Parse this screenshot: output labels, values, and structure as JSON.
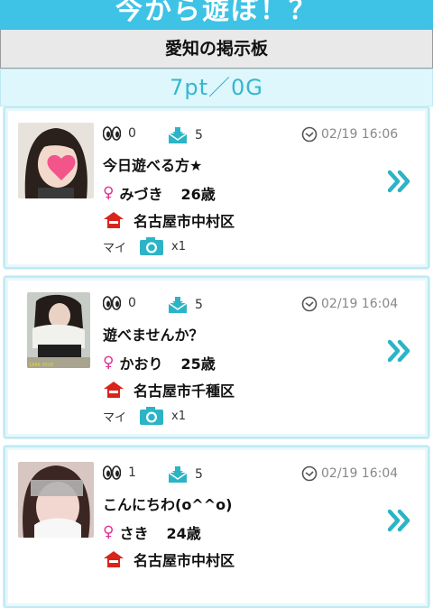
{
  "header": {
    "title": "今から遊ぼ！？"
  },
  "board_title": "愛知の掲示板",
  "points_display": "7pt／0G",
  "colors": {
    "accent": "#3ec3e6",
    "female": "#e0318f",
    "home": "#d9241c",
    "camera": "#2cb4c6"
  },
  "posts": [
    {
      "views": "0",
      "replies": "5",
      "time": "02/19 16:06",
      "title": "今日遊べる方★",
      "gender_icon": "female-symbol",
      "name": "みづき",
      "age": "26歳",
      "area": "名古屋市中村区",
      "photo_label": "マイ",
      "photo_count": "x1"
    },
    {
      "views": "0",
      "replies": "5",
      "time": "02/19 16:04",
      "title": "遊べませんか？",
      "gender_icon": "female-symbol",
      "name": "かおり",
      "age": "25歳",
      "area": "名古屋市千種区",
      "photo_label": "マイ",
      "photo_count": "x1"
    },
    {
      "views": "1",
      "replies": "5",
      "time": "02/19 16:04",
      "title": "こんにちわ(o^^o)",
      "gender_icon": "female-symbol",
      "name": "さき",
      "age": "24歳",
      "area": "名古屋市中村区",
      "photo_label": "",
      "photo_count": ""
    }
  ]
}
